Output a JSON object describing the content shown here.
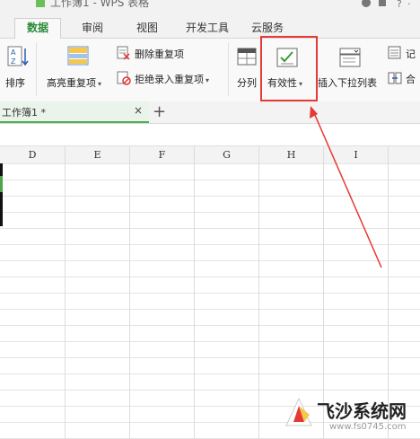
{
  "window": {
    "title": "工作簿1 - WPS 表格"
  },
  "tabs": [
    {
      "label": "数据",
      "active": true
    },
    {
      "label": "审阅"
    },
    {
      "label": "视图"
    },
    {
      "label": "开发工具"
    },
    {
      "label": "云服务"
    }
  ],
  "ribbon": {
    "sort_label": "排序",
    "highlight_dup_label": "高亮重复项",
    "delete_dup_label": "删除重复项",
    "reject_dup_label": "拒绝录入重复项",
    "split_label": "分列",
    "validity_label": "有效性",
    "insert_dropdown_label": "插入下拉列表",
    "record_label": "记",
    "merge_label": "合"
  },
  "document_tab": {
    "name": "工作簿1 *",
    "close": "×",
    "new_tab": "+"
  },
  "columns": [
    "D",
    "E",
    "F",
    "G",
    "H",
    "I"
  ],
  "watermark": {
    "brand": "飞沙系统网",
    "url": "www.fs0745.com"
  },
  "colors": {
    "accent": "#2a8a3a",
    "highlight": "#e53935"
  }
}
